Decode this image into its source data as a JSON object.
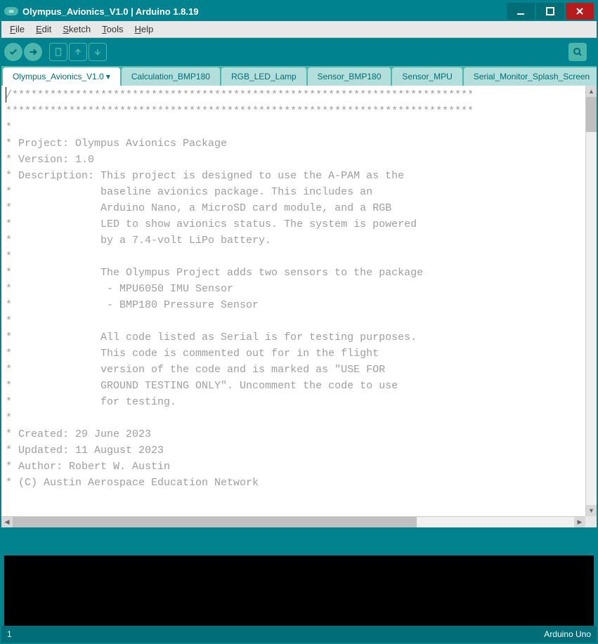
{
  "window": {
    "title": "Olympus_Avionics_V1.0 | Arduino 1.8.19"
  },
  "menu": {
    "file": "File",
    "edit": "Edit",
    "sketch": "Sketch",
    "tools": "Tools",
    "help": "Help"
  },
  "tabs": [
    {
      "label": "Olympus_Avionics_V1.0",
      "active": true
    },
    {
      "label": "Calculation_BMP180",
      "active": false
    },
    {
      "label": "RGB_LED_Lamp",
      "active": false
    },
    {
      "label": "Sensor_BMP180",
      "active": false
    },
    {
      "label": "Sensor_MPU",
      "active": false
    },
    {
      "label": "Serial_Monitor_Splash_Screen",
      "active": false
    }
  ],
  "code": "/*************************************************************************\n**************************************************************************\n*\n* Project: Olympus Avionics Package\n* Version: 1.0\n* Description: This project is designed to use the A-PAM as the\n*              baseline avionics package. This includes an\n*              Arduino Nano, a MicroSD card module, and a RGB\n*              LED to show avionics status. The system is powered\n*              by a 7.4-volt LiPo battery.\n*\n*              The Olympus Project adds two sensors to the package\n*               - MPU6050 IMU Sensor\n*               - BMP180 Pressure Sensor\n*\n*              All code listed as Serial is for testing purposes.\n*              This code is commented out for in the flight\n*              version of the code and is marked as \"USE FOR\n*              GROUND TESTING ONLY\". Uncomment the code to use\n*              for testing.\n*\n* Created: 29 June 2023\n* Updated: 11 August 2023\n* Author: Robert W. Austin\n* (C) Austin Aerospace Education Network",
  "footer": {
    "line": "1",
    "board": "Arduino Uno"
  }
}
